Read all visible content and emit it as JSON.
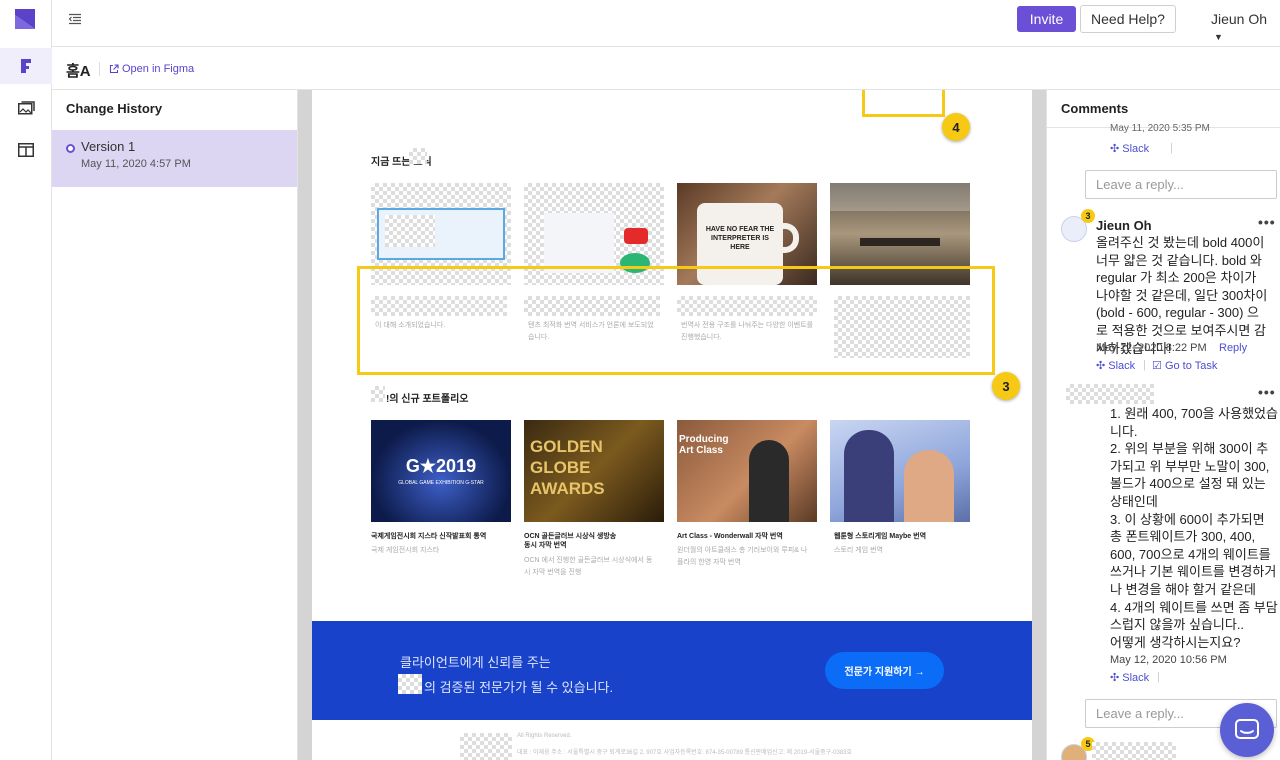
{
  "topbar": {
    "invite_label": "Invite",
    "help_label": "Need Help?",
    "user_name": "Jieun Oh"
  },
  "subbar": {
    "page_title": "홈A",
    "figma_link": "Open in Figma"
  },
  "history": {
    "title": "Change History",
    "versions": [
      {
        "name": "Version 1",
        "date": "May 11, 2020 4:57 PM"
      }
    ]
  },
  "design": {
    "news_title": "지금 뜨는    소식",
    "news_captions": [
      "이 대해 소개되었습니다.",
      "텐츠 최적화 번역 서비스가 언론에 보도되었습니다.",
      "번역사 전용 구조를 나눠주는 다양한 이벤트를 진행했습니다.",
      ""
    ],
    "portfolio_title": "!의 신규 포트폴리오",
    "portfolio": [
      {
        "title": "국제게임전시회 지스타 신작발표회 통역",
        "desc": "국제 게임전시회 지스타",
        "thumb_text": "G★2019",
        "thumb_sub": "GLOBAL GAME EXHIBITION G-STAR"
      },
      {
        "title": "OCN 골든글러브 시상식 생방송 동시 자막 번역",
        "desc": "OCN 에서 진행한 골든글러브 시상식에서 동시 자막 번역을 진행",
        "thumb_text": "GOLDEN GLOBE AWARDS",
        "thumb_sub": ""
      },
      {
        "title": "Art Class - Wonderwall 자막 번역",
        "desc": "원더월의 아트클래스 총 기러보이와 루피& 나플라의 한영 자막 번역",
        "thumb_text": "Producing Art Class",
        "thumb_sub": ""
      },
      {
        "title": "웹툰형 스토리게임 Maybe 번역",
        "desc": "스토리 게임 번역",
        "thumb_text": "",
        "thumb_sub": ""
      }
    ],
    "mug_text": "HAVE NO FEAR THE INTERPRETER IS HERE",
    "banner_line1": "클라이언트에게 신뢰를 주는",
    "banner_line2": "의 검증된 전문가가 될 수 있습니다.",
    "banner_cta": "전문가 지원하기 →",
    "footer_line1": "All Rights Reserved.",
    "footer_line2": "대표 : 이재웅   주소 : 서울특별시 중구 퇴계로36길 2, 907호   사업자등록번호: 874-35-00789   통신판매업신고: 제 2019-서울중구-0383호",
    "pins": [
      "4",
      "3"
    ]
  },
  "comments": {
    "title": "Comments",
    "items": [
      {
        "date": "May 11, 2020 5:35 PM",
        "slack": "Slack",
        "reply_placeholder": "Leave a reply..."
      },
      {
        "badge": "3",
        "author": "Jieun Oh",
        "body": "올려주신 것 봤는데 bold 400이 너무 얇은 것 같습니다. bold 와 regular 가 최소 200은 차이가 나야할 것 같은데, 일단 300차이 (bold - 600, regular - 300) 으로 적용한 것으로 보여주시면 감사하겠습니다!",
        "date": "May 12, 2020 8:22 PM",
        "reply": "Reply",
        "slack": "Slack",
        "task": "Go to Task"
      },
      {
        "body": "1. 원래 400, 700을 사용했었습니다.\n2. 위의 부분을 위해 300이 추가되고 위 부부만 노말이 300, 볼드가 400으로 설정 돼 있는 상태인데\n3. 이 상황에 600이 추가되면 총 폰트웨이트가 300, 400, 600, 700으로 4개의 웨이트를 쓰거나 기본 웨이트를 변경하거나 변경을 해야 할거 같은데\n4. 4개의 웨이트를 쓰면 좀 부담스럽지 않을까 싶습니다..\n어떻게 생각하시는지요?",
        "date": "May 12, 2020 10:56 PM",
        "slack": "Slack",
        "reply_placeholder": "Leave a reply..."
      },
      {
        "badge": "5"
      }
    ]
  },
  "icons": {
    "logo": "brand-logo-icon",
    "menu": "menu-collapse-icon",
    "figma": "figma-icon",
    "gallery": "gallery-icon",
    "layout": "layout-icon",
    "external": "external-link-icon",
    "chat": "chat-icon"
  },
  "colors": {
    "accent": "#6b4fd6",
    "pin": "#f6c915",
    "banner": "#1742c9",
    "link": "#4b4fd0"
  }
}
